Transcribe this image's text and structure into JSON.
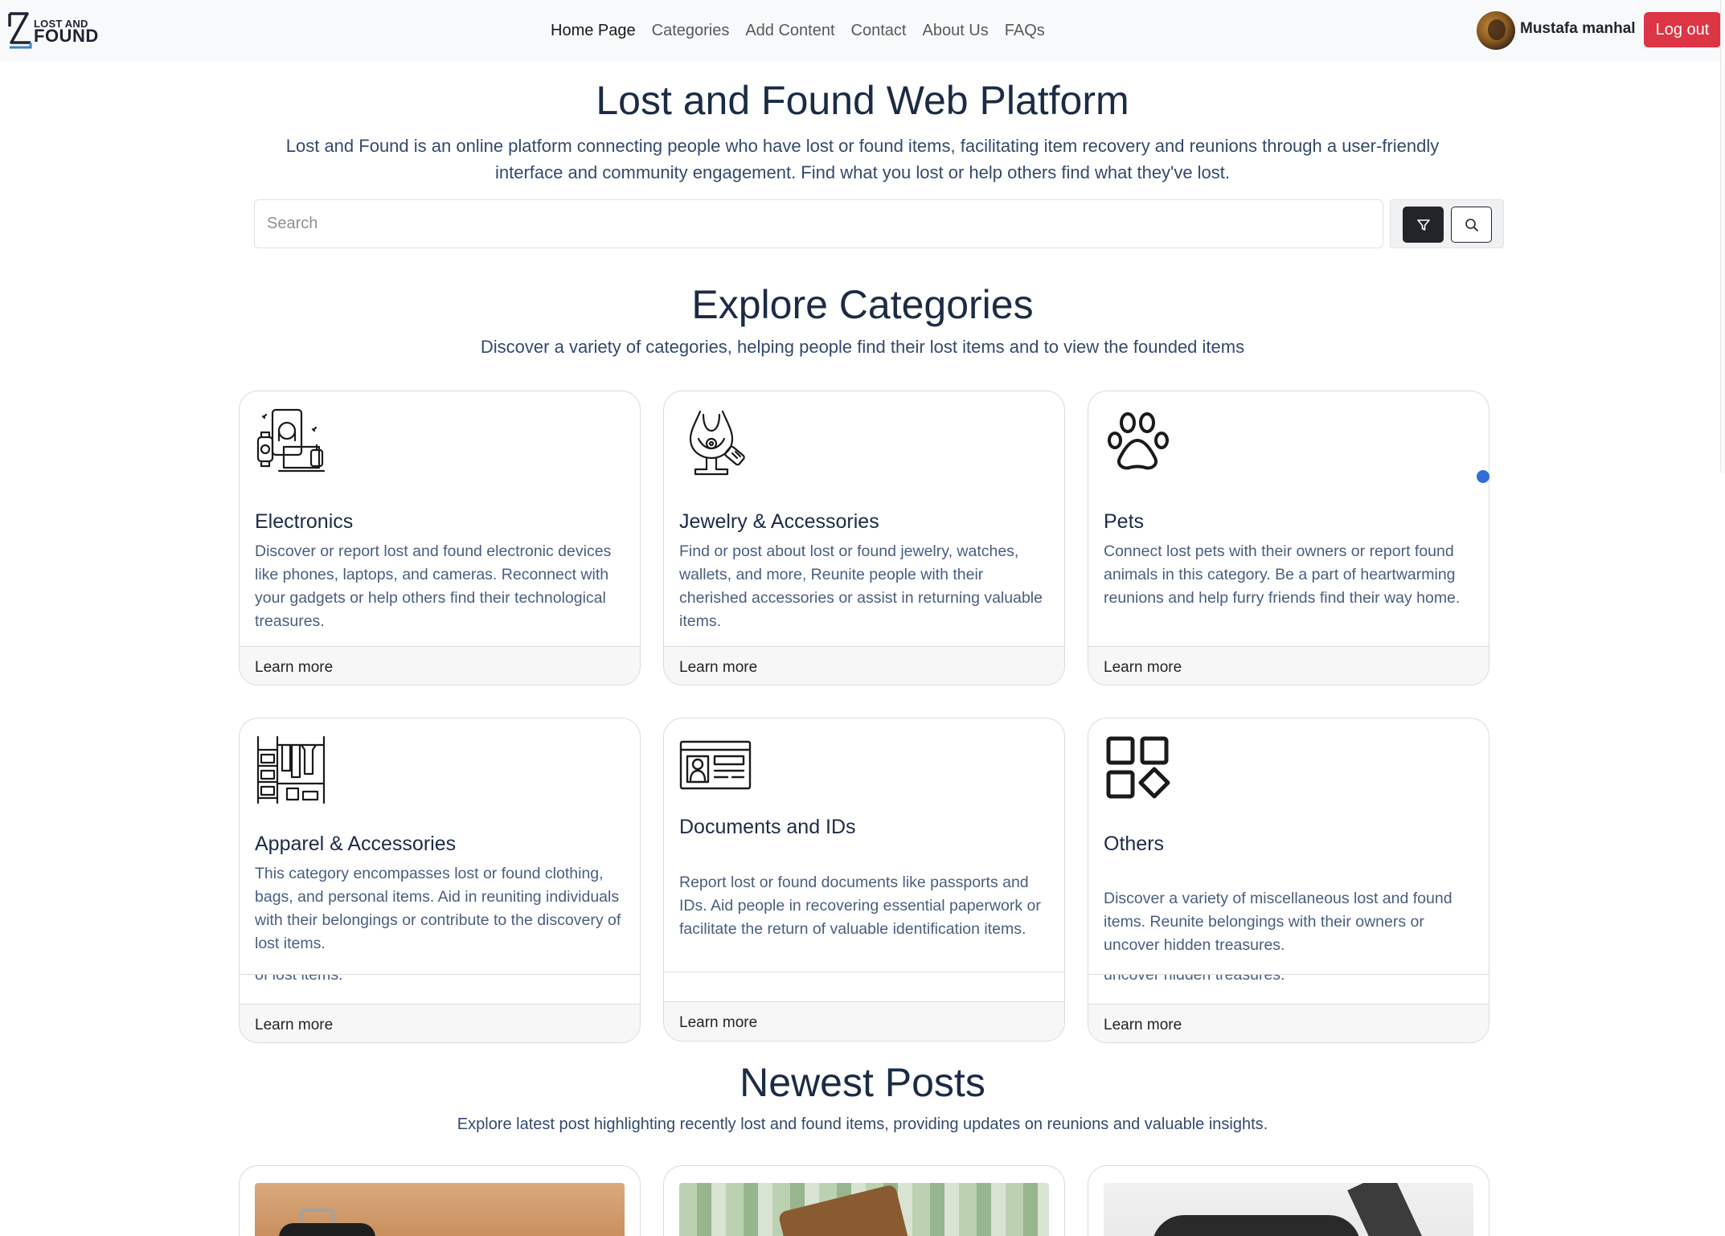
{
  "navbar": {
    "logo_top": "LOST AND",
    "logo_bottom": "FOUND",
    "links": [
      "Home Page",
      "Categories",
      "Add Content",
      "Contact",
      "About Us",
      "FAQs"
    ],
    "user_name": "Mustafa manhal",
    "logout_label": "Log out"
  },
  "hero": {
    "title": "Lost and Found Web Platform",
    "description": "Lost and Found is an online platform connecting people who have lost or found items, facilitating item recovery and reunions through a user-friendly interface and community engagement. Find what you lost or help others find what they've lost."
  },
  "search": {
    "placeholder": "Search",
    "filter_icon": "filter-icon",
    "search_icon": "search-icon"
  },
  "categories_section": {
    "title": "Explore Categories",
    "description": "Discover a variety of categories, helping people find their lost items and to view the founded items",
    "cards": [
      {
        "title": "Electronics",
        "icon": "electronics-icon",
        "text": "Discover or report lost and found electronic devices like phones, laptops, and cameras. Reconnect with your gadgets or help others find their technological treasures.",
        "link": "Learn more"
      },
      {
        "title": "Jewelry & Accessories",
        "icon": "jewelry-icon",
        "text": "Find or post about lost or found jewelry, watches, wallets, and more, Reunite people with their cherished accessories or assist in returning valuable items.",
        "link": "Learn more"
      },
      {
        "title": "Pets",
        "icon": "paw-icon",
        "text": "Connect lost pets with their owners or report found animals in this category. Be a part of heartwarming reunions and help furry friends find their way home.",
        "link": "Learn more"
      },
      {
        "title": "Apparel & Accessories",
        "icon": "wardrobe-icon",
        "text": "This category encompasses lost or found clothing, bags, and personal items. Aid in reuniting individuals with their belongings or contribute to the discovery of lost items.",
        "overflow": "of lost items.",
        "link": "Learn more"
      },
      {
        "title": "Documents and IDs",
        "icon": "id-card-icon",
        "text": "Report lost or found documents like passports and IDs. Aid people in recovering essential paperwork or facilitate the return of valuable identification items.",
        "link": "Learn more"
      },
      {
        "title": "Others",
        "icon": "apps-icon",
        "text": "Discover a variety of miscellaneous lost and found items. Reunite belongings with their owners or uncover hidden treasures.",
        "overflow": "uncover hidden treasures.",
        "link": "Learn more"
      }
    ]
  },
  "posts_section": {
    "title": "Newest Posts",
    "description": "Explore latest post highlighting recently lost and found items, providing updates on reunions and valuable insights."
  },
  "colors": {
    "heading": "#1c2b45",
    "body_text": "#4a5e80",
    "logout": "#dc3545",
    "indicator": "#2f6fd6"
  }
}
